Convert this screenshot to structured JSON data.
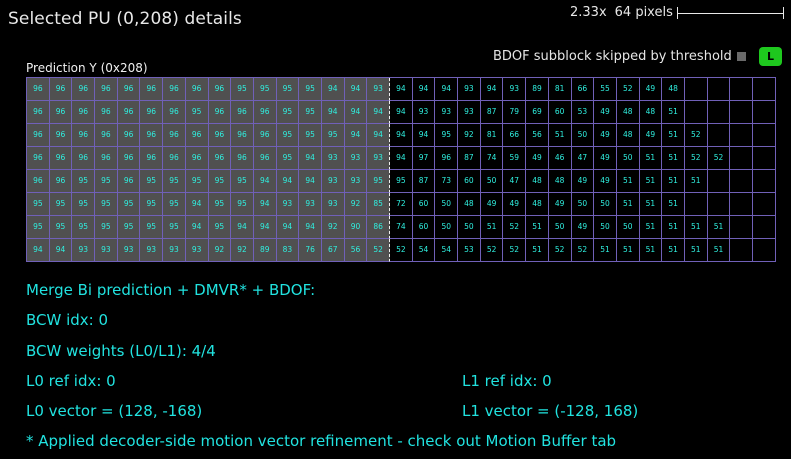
{
  "header": {
    "title": "Selected PU (0,208) details",
    "zoom": "2.33x",
    "scale_text": "64 pixels"
  },
  "bdof": {
    "label": "BDOF subblock skipped by threshold",
    "badge": "L"
  },
  "prediction": {
    "label": "Prediction Y (0x208)",
    "rows": [
      [
        "96",
        "96",
        "96",
        "96",
        "96",
        "96",
        "96",
        "96",
        "96",
        "95",
        "95",
        "95",
        "95",
        "94",
        "94",
        "93",
        "94",
        "94",
        "94",
        "93",
        "94",
        "93",
        "89",
        "81",
        "66",
        "55",
        "52",
        "49",
        "48"
      ],
      [
        "96",
        "96",
        "96",
        "96",
        "96",
        "96",
        "96",
        "95",
        "96",
        "96",
        "96",
        "95",
        "95",
        "94",
        "94",
        "94",
        "94",
        "93",
        "93",
        "93",
        "87",
        "79",
        "69",
        "60",
        "53",
        "49",
        "48",
        "48",
        "51"
      ],
      [
        "96",
        "96",
        "96",
        "96",
        "96",
        "96",
        "96",
        "96",
        "96",
        "96",
        "96",
        "95",
        "95",
        "95",
        "94",
        "94",
        "94",
        "94",
        "95",
        "92",
        "81",
        "66",
        "56",
        "51",
        "50",
        "49",
        "48",
        "49",
        "51",
        "52"
      ],
      [
        "96",
        "96",
        "96",
        "96",
        "96",
        "96",
        "96",
        "96",
        "96",
        "96",
        "96",
        "95",
        "94",
        "93",
        "93",
        "93",
        "94",
        "97",
        "96",
        "87",
        "74",
        "59",
        "49",
        "46",
        "47",
        "49",
        "50",
        "51",
        "51",
        "52",
        "52"
      ],
      [
        "96",
        "96",
        "95",
        "95",
        "96",
        "95",
        "95",
        "95",
        "95",
        "95",
        "94",
        "94",
        "94",
        "93",
        "93",
        "95",
        "95",
        "87",
        "73",
        "60",
        "50",
        "47",
        "48",
        "48",
        "49",
        "49",
        "51",
        "51",
        "51",
        "51"
      ],
      [
        "95",
        "95",
        "95",
        "95",
        "95",
        "95",
        "95",
        "94",
        "95",
        "95",
        "94",
        "93",
        "93",
        "93",
        "92",
        "85",
        "72",
        "60",
        "50",
        "48",
        "49",
        "49",
        "48",
        "49",
        "50",
        "50",
        "51",
        "51",
        "51"
      ],
      [
        "95",
        "95",
        "95",
        "95",
        "95",
        "95",
        "95",
        "94",
        "95",
        "94",
        "94",
        "94",
        "94",
        "92",
        "90",
        "86",
        "74",
        "60",
        "50",
        "50",
        "51",
        "52",
        "51",
        "50",
        "49",
        "50",
        "50",
        "51",
        "51",
        "51",
        "51"
      ],
      [
        "94",
        "94",
        "93",
        "93",
        "93",
        "93",
        "93",
        "93",
        "92",
        "92",
        "89",
        "83",
        "76",
        "67",
        "56",
        "52",
        "52",
        "54",
        "54",
        "53",
        "52",
        "52",
        "51",
        "52",
        "52",
        "51",
        "51",
        "51",
        "51",
        "51",
        "51"
      ]
    ]
  },
  "info": {
    "merge": "Merge Bi prediction + DMVR* + BDOF:",
    "bcw_idx": "BCW idx: 0",
    "bcw_weights": "BCW weights (L0/L1): 4/4",
    "l0_ref": "L0 ref idx: 0",
    "l1_ref": "L1 ref idx: 0",
    "l0_vector": "L0 vector = (128, -168)",
    "l1_vector": "L1 vector = (-128, 168)",
    "note": "* Applied decoder-side motion vector refinement - check out Motion Buffer tab"
  }
}
